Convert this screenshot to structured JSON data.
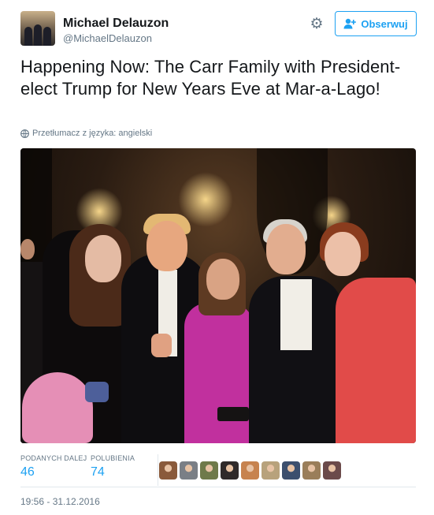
{
  "author": {
    "name": "Michael Delauzon",
    "handle": "@MichaelDelauzon",
    "follow_label": "Obserwuj"
  },
  "tweet": {
    "text": "Happening Now: The Carr Family with President-elect Trump for New Years Eve at Mar-a-Lago!",
    "translate_label": "Przetłumacz z języka: angielski"
  },
  "stats": {
    "retweets_label": "PODANYCH DALEJ",
    "retweets_value": "46",
    "likes_label": "POLUBIENIA",
    "likes_value": "74"
  },
  "likers": [
    {
      "icon": "liker-avatar-1",
      "color": "#8a5a3b"
    },
    {
      "icon": "liker-avatar-2",
      "color": "#7a7f86"
    },
    {
      "icon": "liker-avatar-3",
      "color": "#6f7a4a"
    },
    {
      "icon": "liker-avatar-4",
      "color": "#2f2a2a"
    },
    {
      "icon": "liker-avatar-5",
      "color": "#c7834f"
    },
    {
      "icon": "liker-avatar-6",
      "color": "#b8a27c"
    },
    {
      "icon": "liker-avatar-7",
      "color": "#3c4f6e"
    },
    {
      "icon": "liker-avatar-8",
      "color": "#9a7e5a"
    },
    {
      "icon": "liker-avatar-9",
      "color": "#6b4a4a"
    }
  ],
  "timestamp": "19:56 - 31.12.2016",
  "colors": {
    "accent": "#1da1f2",
    "muted": "#657786",
    "text": "#14171a"
  }
}
